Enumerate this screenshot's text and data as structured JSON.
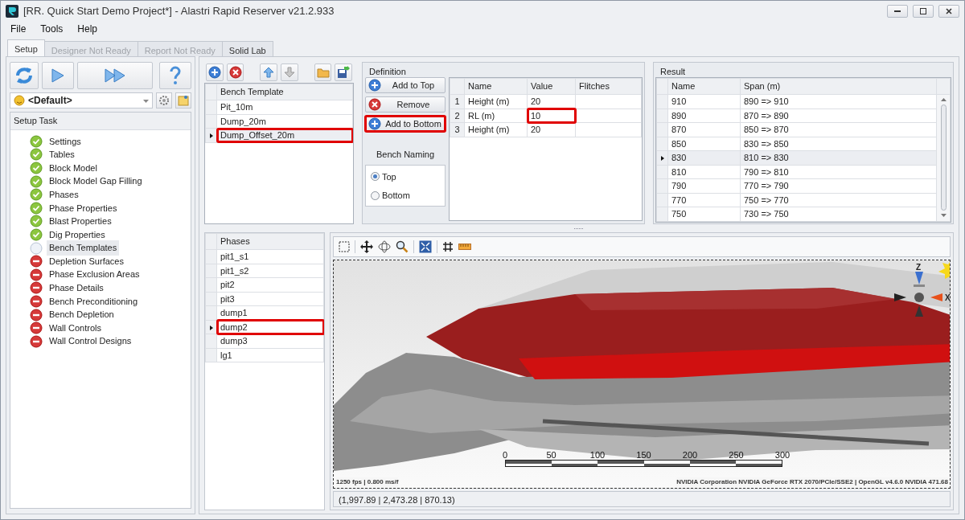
{
  "window": {
    "title": "[RR. Quick Start Demo Project*] - Alastri Rapid Reserver v21.2.933"
  },
  "menu": [
    "File",
    "Tools",
    "Help"
  ],
  "tabs": [
    {
      "label": "Setup",
      "selected": true,
      "disabled": false
    },
    {
      "label": "Designer Not Ready",
      "selected": false,
      "disabled": true
    },
    {
      "label": "Report Not Ready",
      "selected": false,
      "disabled": true
    },
    {
      "label": "Solid Lab",
      "selected": false,
      "disabled": false
    }
  ],
  "setup_task": {
    "profile": "<Default>",
    "header": "Setup Task",
    "items": [
      {
        "label": "Settings",
        "kind": "done",
        "selected": false
      },
      {
        "label": "Tables",
        "kind": "done",
        "selected": false
      },
      {
        "label": "Block Model",
        "kind": "done",
        "selected": false
      },
      {
        "label": "Block Model Gap Filling",
        "kind": "done",
        "selected": false
      },
      {
        "label": "Phases",
        "kind": "done",
        "selected": false
      },
      {
        "label": "Phase Properties",
        "kind": "done",
        "selected": false
      },
      {
        "label": "Blast Properties",
        "kind": "done",
        "selected": false
      },
      {
        "label": "Dig Properties",
        "kind": "done",
        "selected": false
      },
      {
        "label": "Bench Templates",
        "kind": "pending",
        "selected": true
      },
      {
        "label": "Depletion Surfaces",
        "kind": "error",
        "selected": false
      },
      {
        "label": "Phase Exclusion Areas",
        "kind": "error",
        "selected": false
      },
      {
        "label": "Phase Details",
        "kind": "error",
        "selected": false
      },
      {
        "label": "Bench Preconditioning",
        "kind": "error",
        "selected": false
      },
      {
        "label": "Bench Depletion",
        "kind": "error",
        "selected": false
      },
      {
        "label": "Wall Controls",
        "kind": "error",
        "selected": false
      },
      {
        "label": "Wall Control Designs",
        "kind": "error",
        "selected": false
      }
    ]
  },
  "bench_templates": {
    "column": "Bench Template",
    "rows": [
      {
        "name": "Pit_10m",
        "selected": false,
        "highlighted": false
      },
      {
        "name": "Dump_20m",
        "selected": false,
        "highlighted": false
      },
      {
        "name": "Dump_Offset_20m",
        "selected": true,
        "highlighted": true
      }
    ]
  },
  "definition": {
    "title": "Definition",
    "buttons": [
      {
        "label": "Add to Top",
        "kind": "add",
        "highlighted": false
      },
      {
        "label": "Remove",
        "kind": "remove",
        "highlighted": false
      },
      {
        "label": "Add to Bottom",
        "kind": "add",
        "highlighted": true
      }
    ],
    "bench_naming": {
      "title": "Bench Naming",
      "options": [
        {
          "label": "Top",
          "selected": true
        },
        {
          "label": "Bottom",
          "selected": false
        }
      ]
    },
    "columns": [
      "Name",
      "Value",
      "Flitches"
    ],
    "rows": [
      {
        "index": "1",
        "name": "Height (m)",
        "value": "20",
        "highlighted": false
      },
      {
        "index": "2",
        "name": "RL (m)",
        "value": "10",
        "highlighted": true
      },
      {
        "index": "3",
        "name": "Height (m)",
        "value": "20",
        "highlighted": false
      }
    ]
  },
  "result": {
    "title": "Result",
    "columns": [
      "Name",
      "Span (m)"
    ],
    "rows": [
      {
        "name": "910",
        "span": "890 => 910",
        "selected": false
      },
      {
        "name": "890",
        "span": "870 => 890",
        "selected": false
      },
      {
        "name": "870",
        "span": "850 => 870",
        "selected": false
      },
      {
        "name": "850",
        "span": "830 => 850",
        "selected": false
      },
      {
        "name": "830",
        "span": "810 => 830",
        "selected": true
      },
      {
        "name": "810",
        "span": "790 => 810",
        "selected": false
      },
      {
        "name": "790",
        "span": "770 => 790",
        "selected": false
      },
      {
        "name": "770",
        "span": "750 => 770",
        "selected": false
      },
      {
        "name": "750",
        "span": "730 => 750",
        "selected": false
      }
    ]
  },
  "phases": {
    "column": "Phases",
    "rows": [
      {
        "name": "pit1_s1",
        "selected": false,
        "highlighted": false
      },
      {
        "name": "pit1_s2",
        "selected": false,
        "highlighted": false
      },
      {
        "name": "pit2",
        "selected": false,
        "highlighted": false
      },
      {
        "name": "pit3",
        "selected": false,
        "highlighted": false
      },
      {
        "name": "dump1",
        "selected": false,
        "highlighted": false
      },
      {
        "name": "dump2",
        "selected": true,
        "highlighted": true
      },
      {
        "name": "dump3",
        "selected": false,
        "highlighted": false
      },
      {
        "name": "lg1",
        "selected": false,
        "highlighted": false
      }
    ]
  },
  "viewer": {
    "axis_labels": [
      "Z",
      "X"
    ],
    "scale_labels": [
      "0",
      "50",
      "100",
      "150",
      "200",
      "250",
      "300"
    ],
    "fps": "1250 fps | 0.800 ms/f",
    "renderer": "NVIDIA Corporation NVIDIA GeForce RTX 2070/PCIe/SSE2 | OpenGL v4.6.0 NVIDIA 471.68",
    "coordinates": "(1,997.89 | 2,473.28 | 870.13)"
  }
}
